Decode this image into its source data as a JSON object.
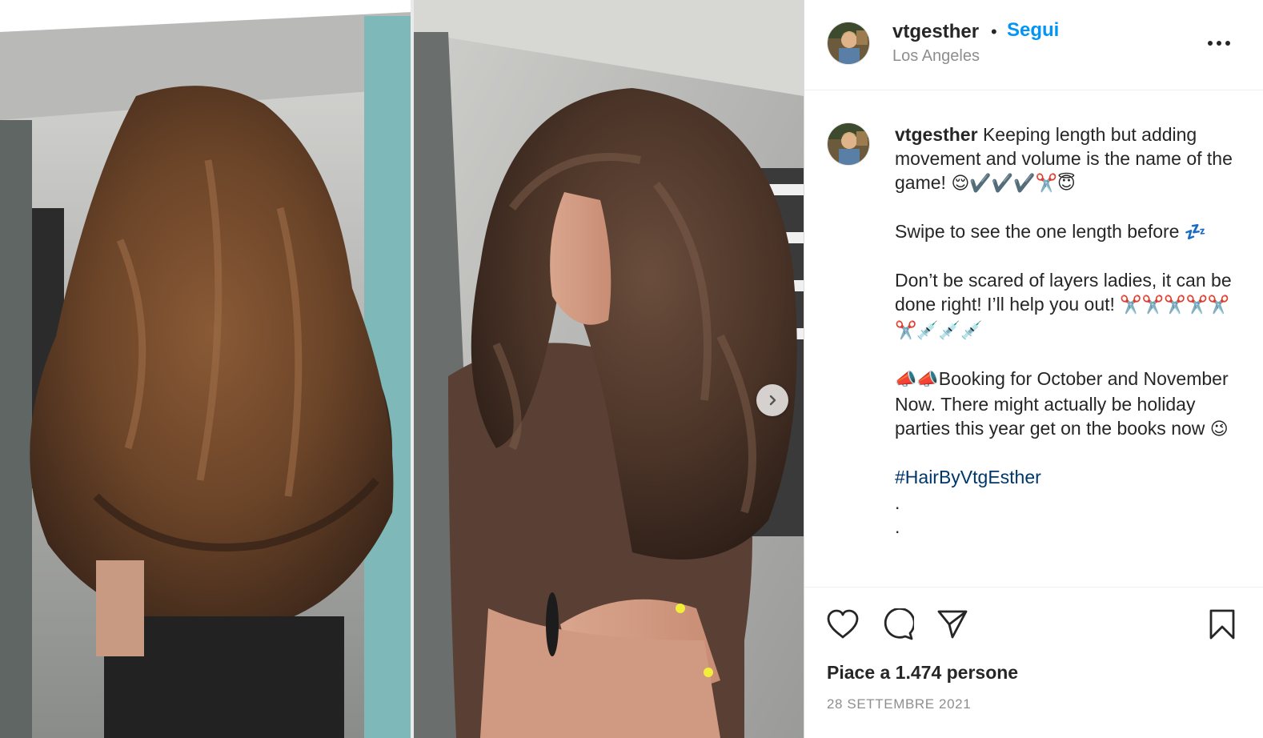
{
  "header": {
    "username": "vtgesther",
    "separator": "•",
    "follow_label": "Segui",
    "location": "Los Angeles",
    "more_icon": "more-horizontal-icon"
  },
  "caption": {
    "username": "vtgesther",
    "para1_text": "Keeping length but adding movement and volume is the name of the game!",
    "para1_emoji": "😌✔️✔️✔️✂️😇",
    "para2_text": "Swipe to see the one length before",
    "para2_emoji": "💤",
    "para3_text": "Don’t be scared of layers ladies, it can be done right! I’ll help you out!",
    "para3_emoji": "✂️✂️✂️✂️✂️✂️💉💉💉",
    "para4_emoji": "📣📣",
    "para4_text": "Booking for October and November Now. There might actually be holiday parties this year get on the books now",
    "para4_end_emoji": "😉",
    "hashtag": "#HairByVtgEsther",
    "dot1": ".",
    "dot2": "."
  },
  "actions": {
    "like_icon": "heart-icon",
    "comment_icon": "comment-icon",
    "share_icon": "send-icon",
    "save_icon": "bookmark-icon",
    "likes_text": "Piace a 1.474 persone",
    "date_text": "28 SETTEMBRE 2021"
  },
  "colors": {
    "link_blue": "#0095f6",
    "hashtag_blue": "#00376b",
    "text": "#262626",
    "muted": "#8e8e8e"
  }
}
